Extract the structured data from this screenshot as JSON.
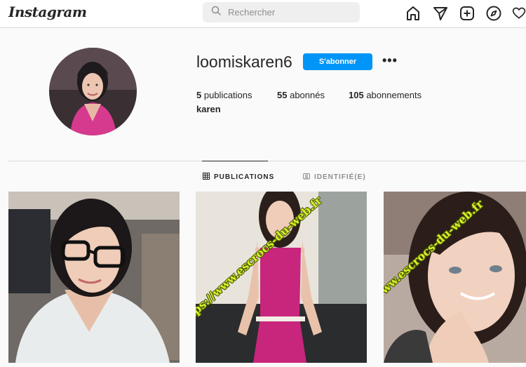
{
  "header": {
    "logo": "Instagram",
    "search_placeholder": "Rechercher",
    "nav_icons": [
      "home-icon",
      "send-icon",
      "new-post-icon",
      "explore-icon",
      "heart-icon"
    ]
  },
  "profile": {
    "username": "loomiskaren6",
    "follow_label": "S'abonner",
    "more_label": "•••",
    "stats": {
      "posts_count": "5",
      "posts_label": "publications",
      "followers_count": "55",
      "followers_label": "abonnés",
      "following_count": "105",
      "following_label": "abonnements"
    },
    "full_name": "karen"
  },
  "tabs": [
    {
      "label": "PUBLICATIONS",
      "icon": "grid-icon",
      "active": true
    },
    {
      "label": "IDENTIFIÉ(E)",
      "icon": "tagged-icon",
      "active": false
    }
  ],
  "posts": [
    {
      "alt": "selfie-with-glasses"
    },
    {
      "alt": "pink-dress-photo",
      "watermark": "https://www.escrocs-du-web.fr"
    },
    {
      "alt": "smiling-portrait",
      "watermark": "https://www.escrocs-du-web.fr"
    }
  ],
  "colors": {
    "accent": "#0095f6",
    "watermark": "#d7ef2a"
  }
}
